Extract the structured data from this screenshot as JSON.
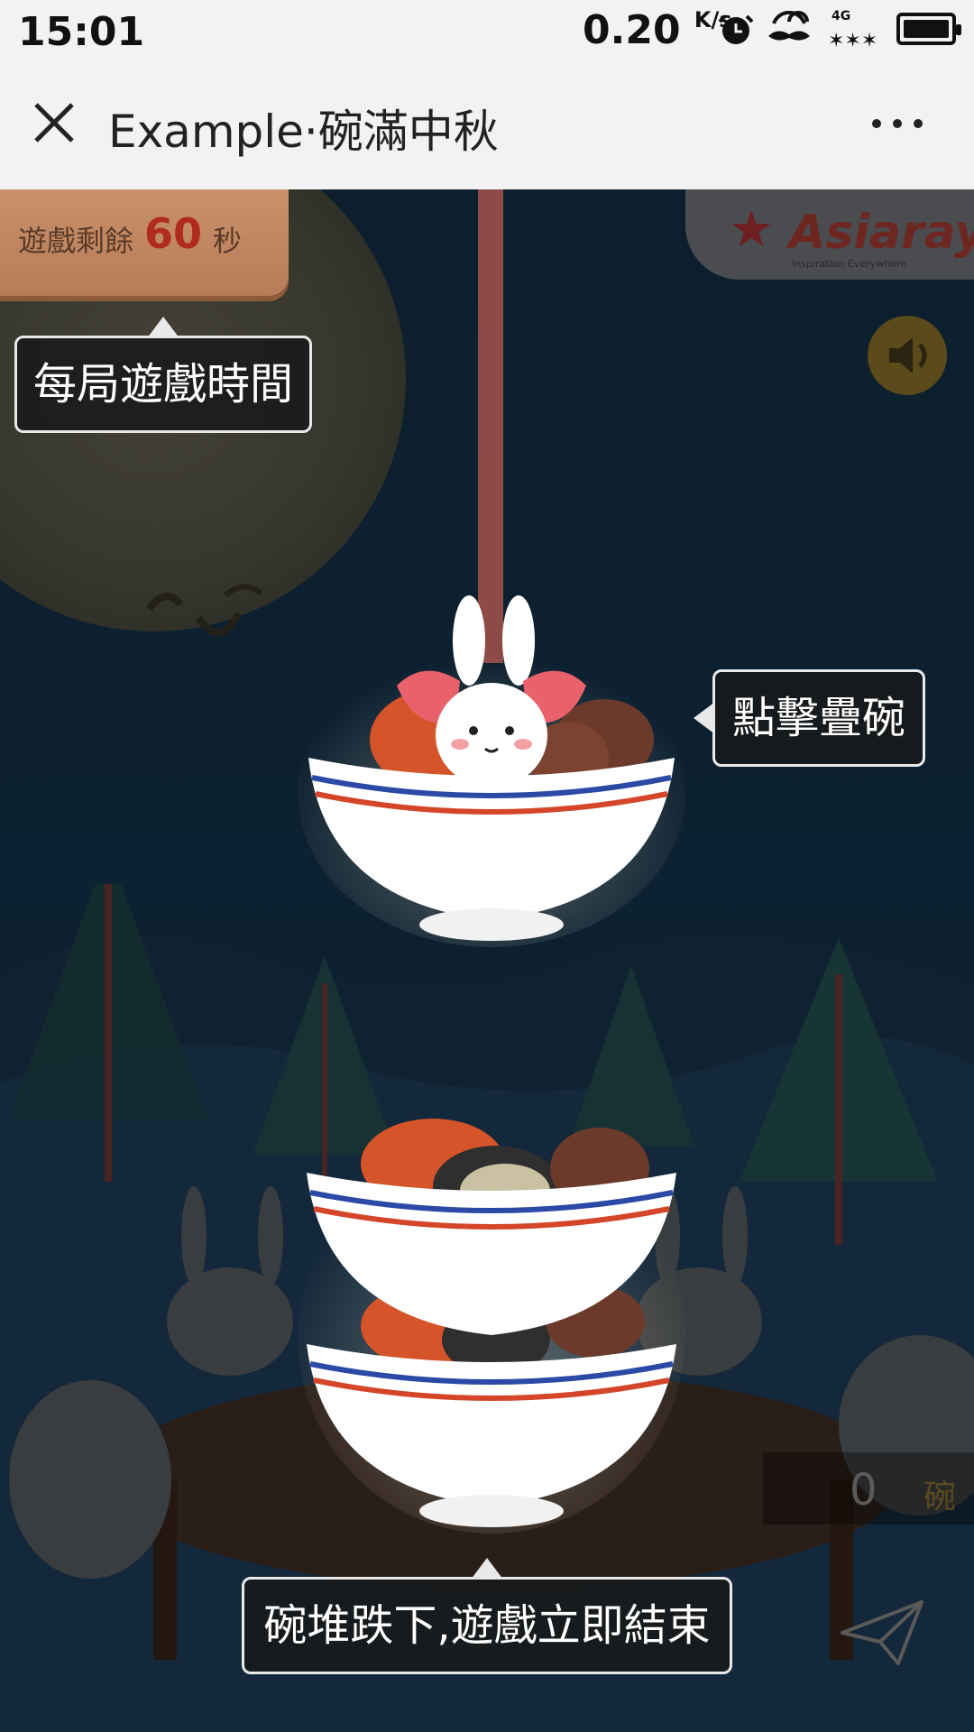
{
  "status_bar": {
    "time": "15:01",
    "speed_value": "0.20",
    "speed_unit": "K/s",
    "icons": [
      "alarm-icon",
      "mustache-icon",
      "wifi-icon",
      "signal-4g-icon",
      "battery-icon"
    ],
    "network_label": "4G"
  },
  "title_bar": {
    "title": "Example·碗滿中秋",
    "close_icon": "close-icon",
    "more_icon": "more-icon"
  },
  "game": {
    "timer": {
      "label": "遊戲剩餘",
      "value": "60",
      "unit": "秒"
    },
    "brand": {
      "name": "Asiaray",
      "tagline": "Inspiration Everywhere"
    },
    "sound_icon": "speaker-icon",
    "tips": {
      "timer_tip": "每局遊戲時間",
      "tap_tip": "點擊疊碗",
      "fall_tip": "碗堆跌下,遊戲立即結束"
    },
    "score": {
      "value": "0",
      "unit": "碗"
    },
    "share_icon": "paper-plane-icon"
  },
  "colors": {
    "background": "#0b1d2b",
    "rope": "#8e4a49",
    "timer_box": "#c9916a",
    "timer_number": "#b02a20",
    "tip_border": "#e9e9e9",
    "bowl_red_stripe": "#d5452a",
    "bowl_blue_stripe": "#2b4aa6"
  }
}
